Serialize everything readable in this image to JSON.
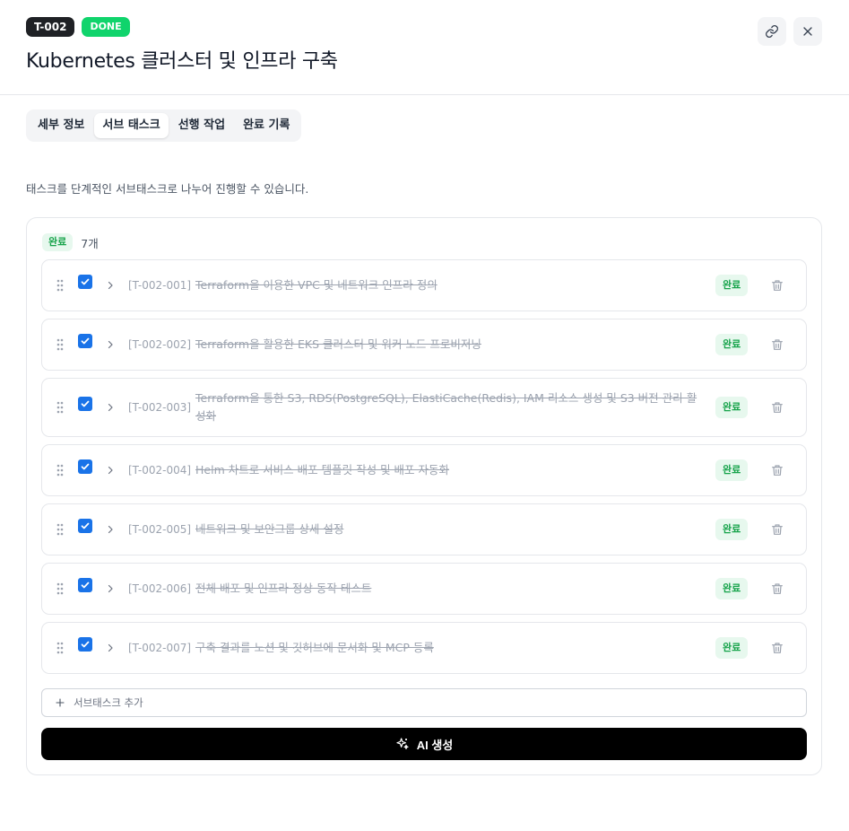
{
  "header": {
    "task_id": "T-002",
    "status": "DONE",
    "title": "Kubernetes 클러스터 및 인프라 구축"
  },
  "tabs": [
    {
      "label": "세부 정보",
      "active": false
    },
    {
      "label": "서브 태스크",
      "active": true
    },
    {
      "label": "선행 작업",
      "active": false
    },
    {
      "label": "완료 기록",
      "active": false
    }
  ],
  "description": "태스크를 단계적인 서브태스크로 나누어 진행할 수 있습니다.",
  "group": {
    "status_label": "완료",
    "count": "7개"
  },
  "subtasks": [
    {
      "code": "[T-002-001]",
      "title": "Terraform을 이용한 VPC 및 네트워크 인프라 정의",
      "status": "완료",
      "checked": true
    },
    {
      "code": "[T-002-002]",
      "title": "Terraform을 활용한 EKS 클러스터 및 워커 노드 프로비저닝",
      "status": "완료",
      "checked": true
    },
    {
      "code": "[T-002-003]",
      "title": "Terraform을 통한 S3, RDS(PostgreSQL), ElastiCache(Redis), IAM 리소스 생성 및 S3 버전 관리 활성화",
      "status": "완료",
      "checked": true
    },
    {
      "code": "[T-002-004]",
      "title": "Helm 차트로 서비스 배포 템플릿 작성 및 배포 자동화",
      "status": "완료",
      "checked": true
    },
    {
      "code": "[T-002-005]",
      "title": "네트워크 및 보안그룹 상세 설정",
      "status": "완료",
      "checked": true
    },
    {
      "code": "[T-002-006]",
      "title": "전체 배포 및 인프라 정상 동작 테스트",
      "status": "완료",
      "checked": true
    },
    {
      "code": "[T-002-007]",
      "title": "구축 결과를 노션 및 깃허브에 문서화 및 MCP 등록",
      "status": "완료",
      "checked": true
    }
  ],
  "add_subtask_label": "서브태스크 추가",
  "ai_button_label": "AI 생성",
  "icons": {
    "link": "link-icon",
    "close": "close-icon",
    "drag": "drag-handle-icon",
    "check": "check-icon",
    "chevron": "chevron-right-icon",
    "trash": "trash-icon",
    "plus": "plus-icon",
    "sparkle": "sparkle-icon"
  },
  "colors": {
    "done_badge": "#10d46c",
    "status_badge_bg": "#e7f8ee",
    "status_badge_text": "#16a34a",
    "checkbox": "#1a73e8",
    "ai_button": "#000000"
  }
}
